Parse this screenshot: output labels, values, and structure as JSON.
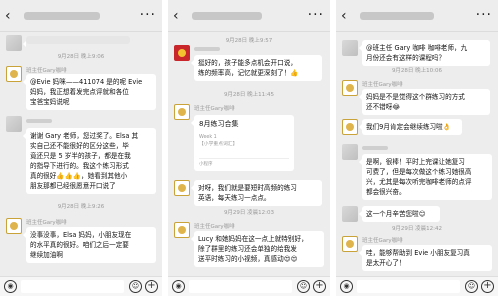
{
  "nav": {
    "back_glyph": "‹",
    "more_glyph": "···"
  },
  "icons": {
    "voice": "voice-icon",
    "emoji": "emoji-icon",
    "plus": "plus-icon",
    "voice_glyph": "◉",
    "emoji_glyph": "☺",
    "plus_glyph": "+"
  },
  "panel1": {
    "timestamps": [
      "9月28日 晚上9:06",
      "9月28日 晚上9:26"
    ],
    "senders": [
      "班主任Gary咖啡",
      "班主任Gary咖啡",
      "班主任Gary咖啡"
    ],
    "messages": [
      {
        "lines": [
          "@Evie 妈咪——411074 是的呢 Evie",
          "妈妈，我正想着发完点评就和各位",
          "宝爸宝妈说呢"
        ]
      },
      {
        "lines": [
          "谢谢 Gary 老师，您过奖了。Elsa 其",
          "实自己还不能很好的区分这些，毕",
          "竟还只是 5 岁半的孩子，都是在我",
          "的指导下进行的。我这个练习形式",
          "真的很好👍👍👍，她看到其他小",
          "朋友那都已经很愿意开口说了"
        ]
      },
      {
        "lines": [
          "没事没事，Elsa 妈妈，小朋友现在",
          "的水平真的很好。咱们之后一定要",
          "继续加油啊"
        ]
      }
    ]
  },
  "panel2": {
    "timestamps": [
      "9月28日 晚上9:57",
      "9月28日 晚上11:45",
      "9月29日 凌晨12:03"
    ],
    "senders": [
      "班主任Gary咖啡",
      "班主任Gary咖啡"
    ],
    "messages": [
      {
        "lines": [
          "挺好的，孩子能多点机会开口说，",
          "练的频率高，记忆就更深刻了！👍"
        ]
      },
      {
        "lines": [
          "对呀，我们就是要短时高频的练习",
          "英语，每天练习一点点。"
        ]
      },
      {
        "lines": [
          "Lucy 和她妈妈在这一点上就特别好，",
          "除了群里的练习还会单独的给我发",
          "送平时练习的小视频，真感动😍😍"
        ]
      }
    ],
    "card": {
      "title": "8月练习合集",
      "lines": [
        "Week 1",
        "【小学重点词汇】"
      ],
      "footer": "小程序"
    }
  },
  "panel3": {
    "timestamps": [
      "9月28日 晚上10:06",
      "9月29日 凌晨12:42"
    ],
    "senders": [
      "班主任Gary咖啡",
      "班主任Gary咖啡"
    ],
    "messages": [
      {
        "lines": [
          "@班主任 Gary 咖啡  咖啡老师，九",
          "月份还会有这样的课程吗？"
        ]
      },
      {
        "lines": [
          "妈妈是不是觉得这个群练习的方式",
          "还不错呀😂"
        ]
      },
      {
        "lines": [
          "我们9月肯定会继续练习啦👌"
        ]
      },
      {
        "lines": [
          "是啊，很棒！平时上完课让她复习",
          "可费了，但是每次做这个练习她很高",
          "兴，尤其是每次听完咖啡老师的点评",
          "都会很兴奋。"
        ]
      },
      {
        "lines": [
          "这一个月辛苦您啦😊"
        ]
      },
      {
        "lines": [
          "哇，能够帮助到 Evie 小朋友复习真",
          "是太开心了！"
        ]
      }
    ]
  }
}
